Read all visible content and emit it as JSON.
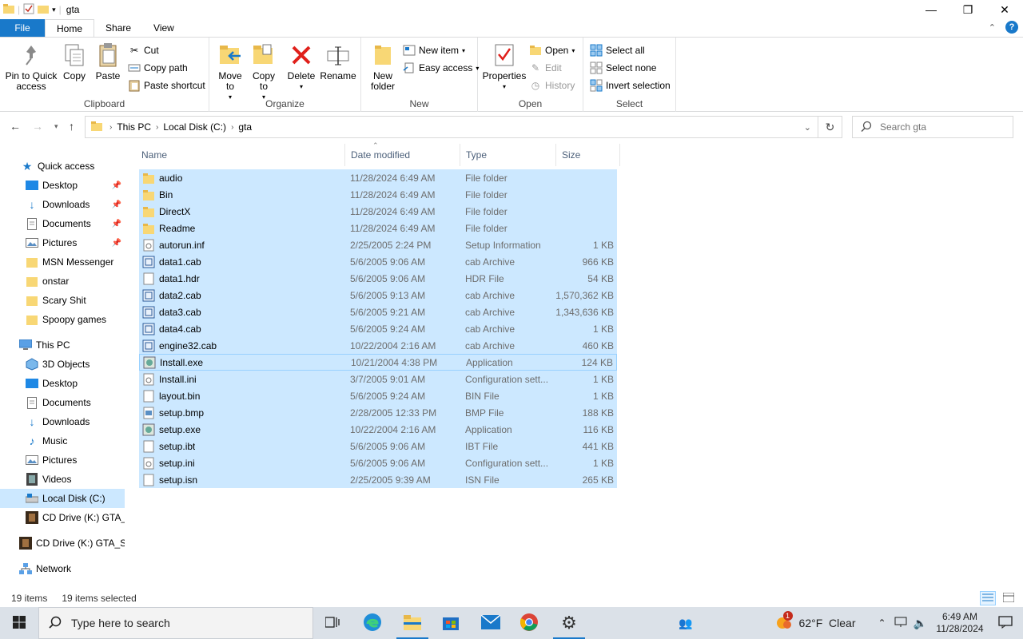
{
  "window": {
    "title": "gta",
    "minimize": "—",
    "maximize": "❐",
    "close": "✕"
  },
  "tabs": {
    "file": "File",
    "home": "Home",
    "share": "Share",
    "view": "View"
  },
  "ribbon": {
    "clipboard": {
      "label": "Clipboard",
      "pin": "Pin to Quick access",
      "copy": "Copy",
      "paste": "Paste",
      "cut": "Cut",
      "copy_path": "Copy path",
      "paste_shortcut": "Paste shortcut"
    },
    "organize": {
      "label": "Organize",
      "move_to": "Move to",
      "copy_to": "Copy to",
      "delete": "Delete",
      "rename": "Rename"
    },
    "new": {
      "label": "New",
      "new_folder": "New folder",
      "new_item": "New item",
      "easy_access": "Easy access"
    },
    "open": {
      "label": "Open",
      "properties": "Properties",
      "open": "Open",
      "edit": "Edit",
      "history": "History"
    },
    "select": {
      "label": "Select",
      "select_all": "Select all",
      "select_none": "Select none",
      "invert_selection": "Invert selection"
    }
  },
  "address": {
    "crumbs": [
      "This PC",
      "Local Disk (C:)",
      "gta"
    ],
    "search_placeholder": "Search gta"
  },
  "sidebar": {
    "quick_access": "Quick access",
    "quick_items": [
      "Desktop",
      "Downloads",
      "Documents",
      "Pictures",
      "MSN Messenger",
      "onstar",
      "Scary Shit",
      "Spoopy games"
    ],
    "this_pc": "This PC",
    "pc_items": [
      "3D Objects",
      "Desktop",
      "Documents",
      "Downloads",
      "Music",
      "Pictures",
      "Videos",
      "Local Disk (C:)",
      "CD Drive (K:) GTA_S"
    ],
    "cd_drive": "CD Drive (K:) GTA_SA",
    "network": "Network"
  },
  "columns": {
    "name": "Name",
    "date": "Date modified",
    "type": "Type",
    "size": "Size"
  },
  "files": [
    {
      "name": "audio",
      "date": "11/28/2024 6:49 AM",
      "type": "File folder",
      "size": "",
      "icon": "folder"
    },
    {
      "name": "Bin",
      "date": "11/28/2024 6:49 AM",
      "type": "File folder",
      "size": "",
      "icon": "folder"
    },
    {
      "name": "DirectX",
      "date": "11/28/2024 6:49 AM",
      "type": "File folder",
      "size": "",
      "icon": "folder"
    },
    {
      "name": "Readme",
      "date": "11/28/2024 6:49 AM",
      "type": "File folder",
      "size": "",
      "icon": "folder"
    },
    {
      "name": "autorun.inf",
      "date": "2/25/2005 2:24 PM",
      "type": "Setup Information",
      "size": "1 KB",
      "icon": "settings-file"
    },
    {
      "name": "data1.cab",
      "date": "5/6/2005 9:06 AM",
      "type": "cab Archive",
      "size": "966 KB",
      "icon": "cab"
    },
    {
      "name": "data1.hdr",
      "date": "5/6/2005 9:06 AM",
      "type": "HDR File",
      "size": "54 KB",
      "icon": "blank-file"
    },
    {
      "name": "data2.cab",
      "date": "5/6/2005 9:13 AM",
      "type": "cab Archive",
      "size": "1,570,362 KB",
      "icon": "cab"
    },
    {
      "name": "data3.cab",
      "date": "5/6/2005 9:21 AM",
      "type": "cab Archive",
      "size": "1,343,636 KB",
      "icon": "cab"
    },
    {
      "name": "data4.cab",
      "date": "5/6/2005 9:24 AM",
      "type": "cab Archive",
      "size": "1 KB",
      "icon": "cab"
    },
    {
      "name": "engine32.cab",
      "date": "10/22/2004 2:16 AM",
      "type": "cab Archive",
      "size": "460 KB",
      "icon": "cab"
    },
    {
      "name": "Install.exe",
      "date": "10/21/2004 4:38 PM",
      "type": "Application",
      "size": "124 KB",
      "icon": "exe"
    },
    {
      "name": "Install.ini",
      "date": "3/7/2005 9:01 AM",
      "type": "Configuration sett...",
      "size": "1 KB",
      "icon": "settings-file"
    },
    {
      "name": "layout.bin",
      "date": "5/6/2005 9:24 AM",
      "type": "BIN File",
      "size": "1 KB",
      "icon": "blank-file"
    },
    {
      "name": "setup.bmp",
      "date": "2/28/2005 12:33 PM",
      "type": "BMP File",
      "size": "188 KB",
      "icon": "image-file"
    },
    {
      "name": "setup.exe",
      "date": "10/22/2004 2:16 AM",
      "type": "Application",
      "size": "116 KB",
      "icon": "exe"
    },
    {
      "name": "setup.ibt",
      "date": "5/6/2005 9:06 AM",
      "type": "IBT File",
      "size": "441 KB",
      "icon": "blank-file"
    },
    {
      "name": "setup.ini",
      "date": "5/6/2005 9:06 AM",
      "type": "Configuration sett...",
      "size": "1 KB",
      "icon": "settings-file"
    },
    {
      "name": "setup.isn",
      "date": "2/25/2005 9:39 AM",
      "type": "ISN File",
      "size": "265 KB",
      "icon": "blank-file"
    }
  ],
  "status": {
    "items": "19 items",
    "selected": "19 items selected"
  },
  "taskbar": {
    "search_placeholder": "Type here to search",
    "weather": "62°F  Clear",
    "time": "6:49 AM",
    "date": "11/28/2024",
    "weather_badge": "1"
  },
  "colors": {
    "accent": "#1979ca",
    "selection": "#cce8ff",
    "folder": "#f8d775"
  }
}
